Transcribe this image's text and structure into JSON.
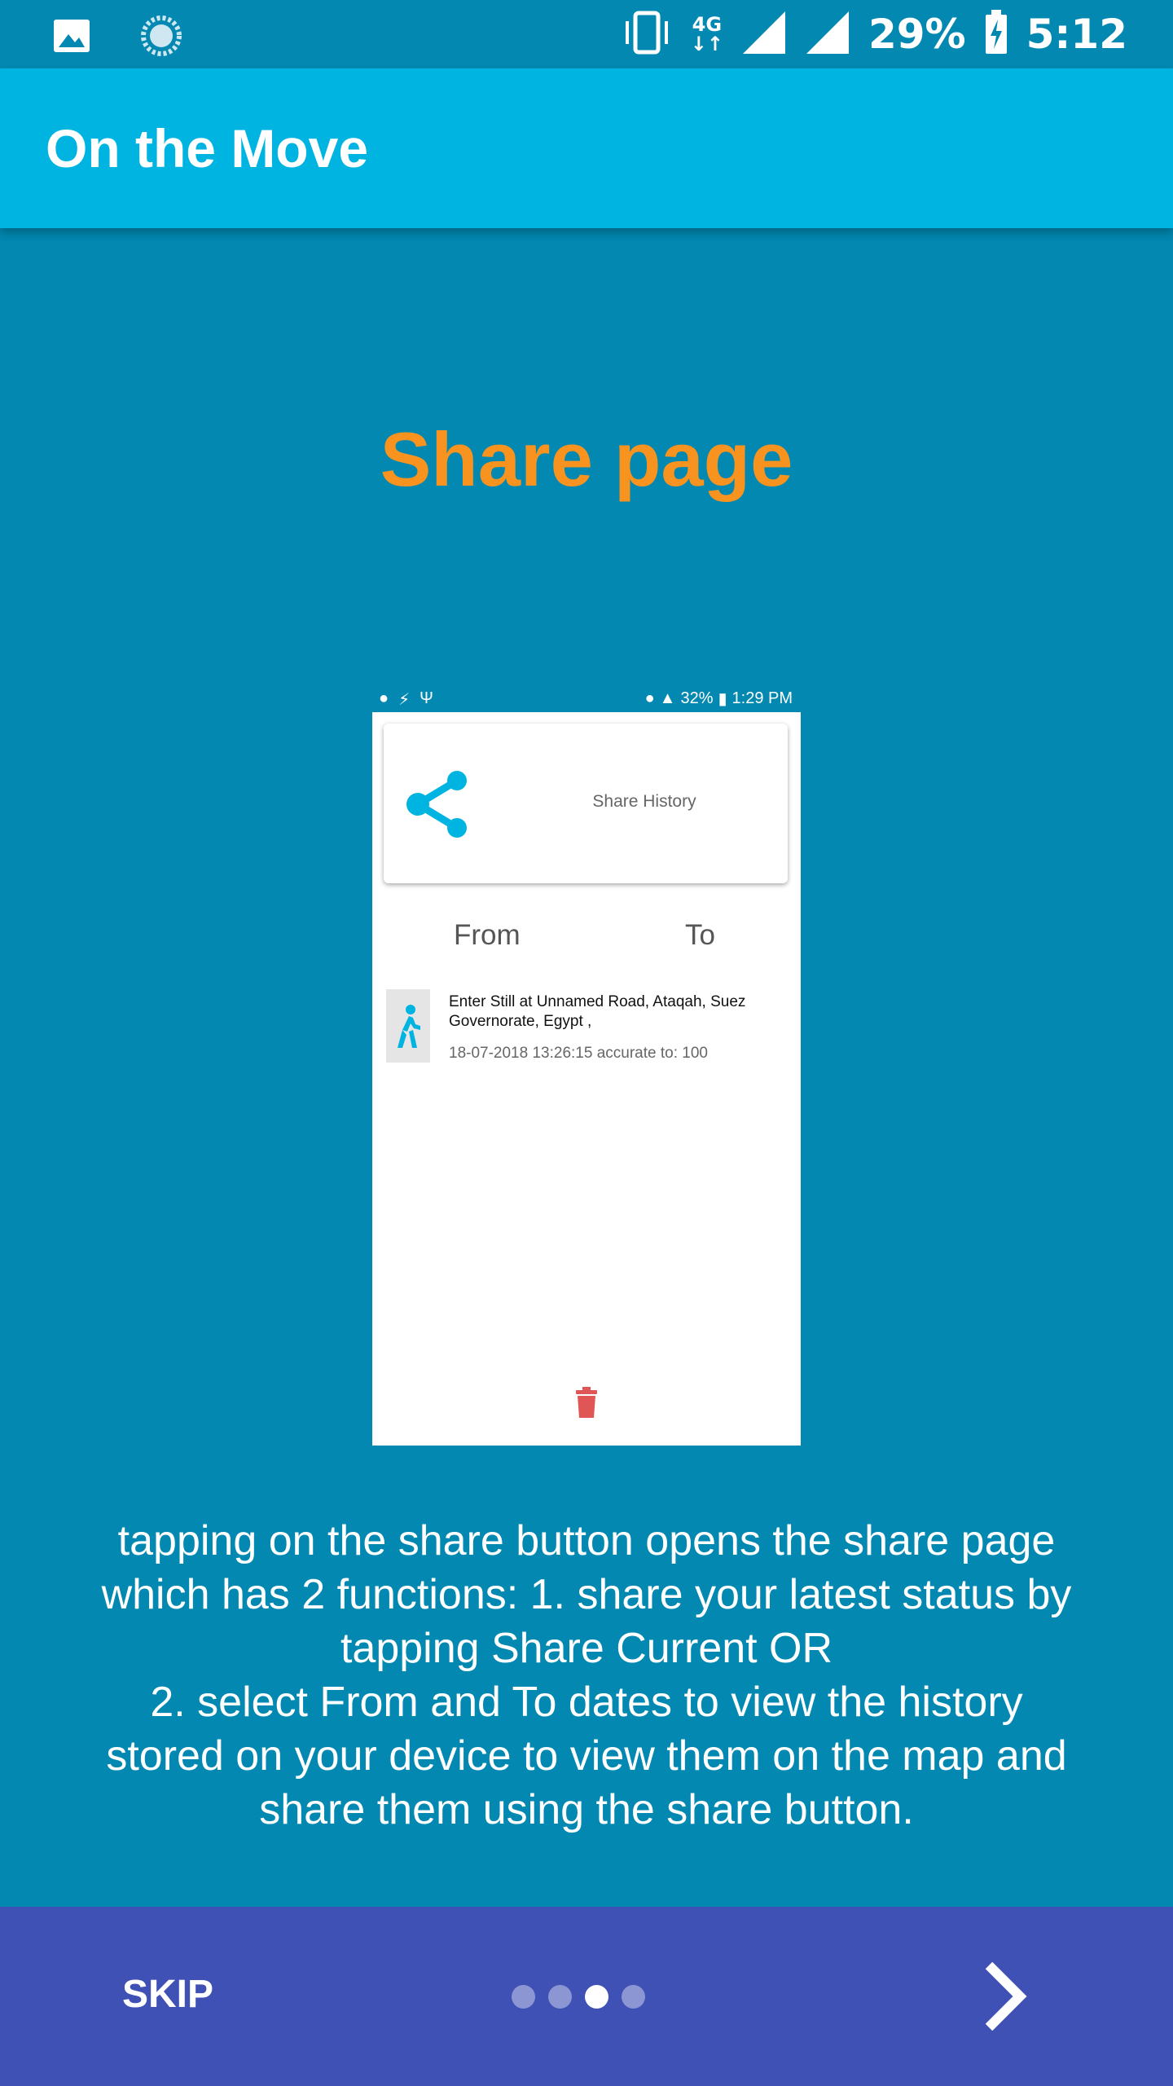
{
  "status_bar": {
    "network": "4G",
    "battery": "29%",
    "time": "5:12"
  },
  "app_bar": {
    "title": "On the Move"
  },
  "onboarding": {
    "title": "Share page",
    "description_lines": [
      "tapping on the share button opens the share page",
      "which has 2 functions: 1. share your latest status by",
      "tapping Share Current OR",
      "2. select From and To dates to view the history",
      "stored on your device to view them on the map and",
      "share them using the share button."
    ]
  },
  "preview": {
    "status": {
      "battery": "32%",
      "time": "1:29 PM"
    },
    "share_card_label": "Share History",
    "from_label": "From",
    "to_label": "To",
    "entry": {
      "title": "Enter Still at Unnamed Road, Ataqah, Suez Governorate, Egypt ,",
      "meta": "18-07-2018 13:26:15 accurate to: 100"
    }
  },
  "bottom_bar": {
    "skip_label": "SKIP",
    "page_count": 4,
    "active_page": 3
  },
  "colors": {
    "background": "#0288b1",
    "app_bar": "#00b4e2",
    "title_accent": "#f7931e",
    "bottom_bar": "#3f51b5",
    "share_icon": "#00b4e2",
    "trash_icon": "#e05555"
  }
}
